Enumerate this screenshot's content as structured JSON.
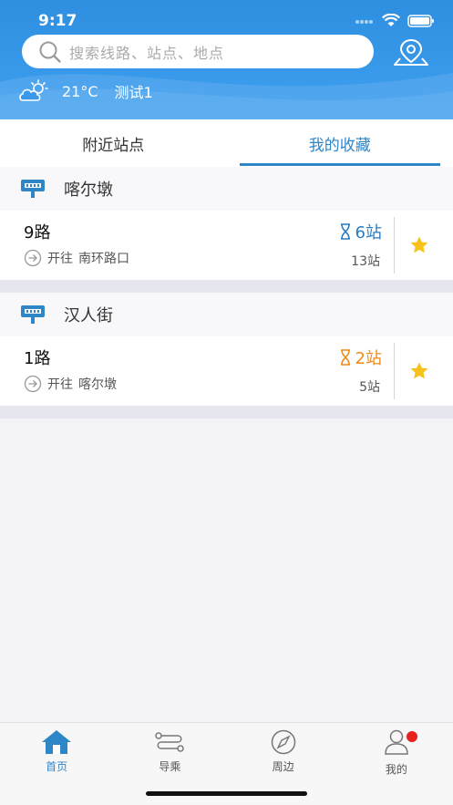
{
  "status_bar": {
    "time": "9:17"
  },
  "header": {
    "search": {
      "placeholder": "搜索线路、站点、地点"
    },
    "weather": {
      "temperature": "21°C",
      "location": "测试1"
    }
  },
  "tabs": [
    {
      "label": "附近站点",
      "active": false
    },
    {
      "label": "我的收藏",
      "active": true
    }
  ],
  "favorites": [
    {
      "stop_name": "喀尔墩",
      "route": "9路",
      "direction_label": "开往",
      "destination": "南环路口",
      "eta": "6站",
      "eta_color": "#2a7bbf",
      "distance": "13站",
      "starred": true
    },
    {
      "stop_name": "汉人街",
      "route": "1路",
      "direction_label": "开往",
      "destination": "喀尔墩",
      "eta": "2站",
      "eta_color": "#f08a1a",
      "distance": "5站",
      "starred": true
    }
  ],
  "bottom_nav": [
    {
      "label": "首页",
      "icon": "home-icon",
      "active": true
    },
    {
      "label": "导乘",
      "icon": "route-icon",
      "active": false
    },
    {
      "label": "周边",
      "icon": "compass-icon",
      "active": false
    },
    {
      "label": "我的",
      "icon": "user-icon",
      "active": false,
      "badge": true
    }
  ],
  "colors": {
    "brand_blue": "#2f86c7",
    "header_blue": "#3a98ea",
    "eta_orange": "#f08a1a",
    "star_yellow": "#f6c21b",
    "badge_red": "#e5221d"
  }
}
